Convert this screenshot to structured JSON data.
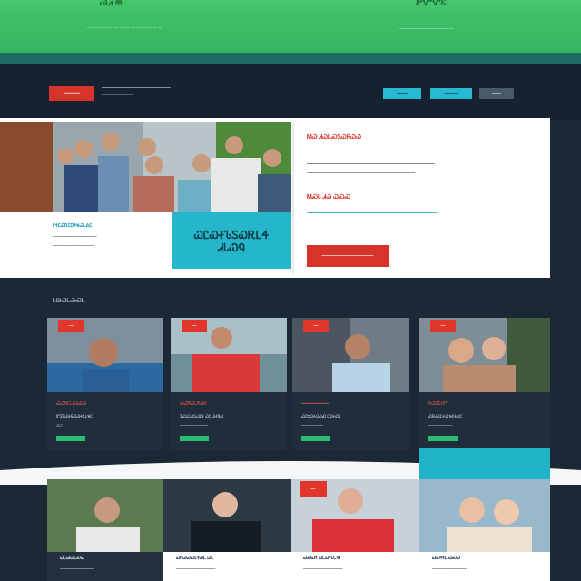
{
  "topbar": {
    "logo": "Ꮚ⩘ ⊕",
    "tagline": "——————————————",
    "right_logo": "ᏑᏉᏉᏋ",
    "right_text": "——————————————————",
    "right_sub": "————————————"
  },
  "nav": {
    "brand": "━━━━━━",
    "tagline": "━━━━━━━━━━━━━━━━━━━━━━━━━━━━",
    "tagline2": "━━━━━━━━━━━━━━",
    "buttons": [
      "━━━━━",
      "━━━━━━",
      "━━━━"
    ]
  },
  "hero": {
    "caption_title": "ᏑᏐᏝᏇᎡᏝᎠᏎᏠᏊᏞᎣᏝ",
    "caption_line1": "━━━━━━━━━━━━━━━━━━",
    "caption_line2": "━━━━━━━━━━━━━━━━━",
    "box_line1": "ᏇᏝᏇᏐᏖᏚᏇᎡᏞᏎ",
    "box_line2": "ᏗᏓᏇᏄ",
    "heading1": "ᎷᏇ ᏗᏇᏞᏍᏚᏇᏒᏇᏇ",
    "para1": "━━━━━━━━━━━━━━━━━━━━━━━━━━━━",
    "para2": "━━━━━━━━━━━━━━━━━━━━━━━━━━━━━━━━━━━━━━━━━━━━━━━━━━━━",
    "para3": "━━━━━━━━━━━━━━━━━━━━━━━━━━━━━━━━━━━━━━━━━━━━",
    "para4": "━━━━━━━━━━━━━━━━━━━━━━━━━━━━━━━━━━━━",
    "heading2": "ᎷᏍᏓ ᏗᏇ ᏇᏍᏍ",
    "para5": "━━━━━━━━━━━━━━━━━━━━━━━━━━━━━━━━━━━━━━━━━━━━━━━━━━━━━",
    "para6": "━━━━━━━━━━━━━━━━━━━━━━━━━━━━━━━━━━━━━━━━",
    "para7": "━━━━━━━━━━━━━━━━",
    "cta": "━━━━━━━━━━━━━━━━━━━━━"
  },
  "section": {
    "title": "Ꮣ₪ᏇᏞᏇᏍᏞ"
  },
  "cards": [
    {
      "badge": "━━",
      "title": "ᏍᏇᏌᏝᏓᏐᏇᏍᏊ",
      "line1": "ᏛᏆᏒᏇᏐᏋᏇᏇᏐᏟᏞᏠᏝ",
      "line2": "ᏇᏇ",
      "pill": "━━━"
    },
    {
      "badge": "━━",
      "title": "ᏍᏇᏒᏇᏓᏒᏇᏌ",
      "line1": "ᏆᏇᏓᏝᏇᏚᏇᏝᏐ ᏇᏝ ᏇᏐᏕᏇ",
      "line2": "━━━━━━━━━━━━━",
      "pill": "━━━"
    },
    {
      "badge": "━━",
      "title": "━━━━━━━━━━",
      "line1": "ᏇᏝᏌᏇᏐᏇᏇᏍ ᏝᏇᏐᏇᏝ",
      "line2": "━━━━━━━━━━",
      "pill": "━━━"
    },
    {
      "badge": "━━",
      "title": "ᏌᏇᏆᏝᏐᏛ",
      "line1": "ᏇᏒᏗᏇᏝᏐᏇ ᏠᏝᏐᏇᏟ",
      "line2": "━━━━━━━━━━━",
      "pill": "━━━"
    }
  ],
  "row2": [
    {
      "caption": "ᏇᏝᏊᏇᏝᏍᏇ",
      "sub": "━━━━━━━━━━━━━━"
    },
    {
      "caption": "ᏇᏒᏇᏇᏍᏝᏐᏇᏝ ᏇᏝ",
      "sub": "━━━━━━━━━━━━━━━━"
    },
    {
      "badge": "━━",
      "caption": "ᏇᏍᏇᏐ ᏇᏝᏇᏐᏓᏟᏠ",
      "sub": "━━━━━━━━━━━━━━━━"
    },
    {
      "caption": "ᏇᏍᏐᏐᏝ ᏇᏍᏇ",
      "sub": "━━━━━━━━━━━━━━"
    }
  ],
  "colors": {
    "accent_red": "#d6332b",
    "accent_teal": "#25b6cc",
    "accent_green": "#2abf6d",
    "bg_dark": "#1b2836"
  }
}
